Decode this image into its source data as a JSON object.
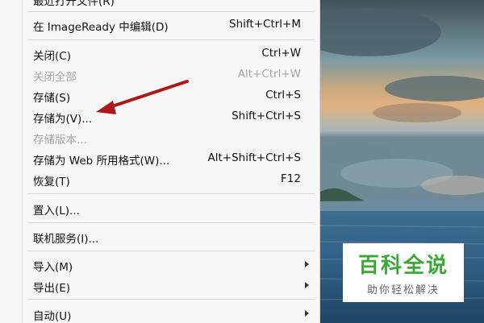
{
  "menu": {
    "top_partial": "最近打开文件(R)",
    "items": [
      {
        "label": "在 ImageReady 中编辑(D)",
        "shortcut": "Shift+Ctrl+M",
        "disabled": false
      },
      {
        "label": "关闭(C)",
        "shortcut": "Ctrl+W",
        "disabled": false
      },
      {
        "label": "关闭全部",
        "shortcut": "Alt+Ctrl+W",
        "disabled": true
      },
      {
        "label": "存储(S)",
        "shortcut": "Ctrl+S",
        "disabled": false
      },
      {
        "label": "存储为(V)...",
        "shortcut": "Shift+Ctrl+S",
        "disabled": false
      },
      {
        "label": "存储版本...",
        "shortcut": "",
        "disabled": true
      },
      {
        "label": "存储为 Web 所用格式(W)...",
        "shortcut": "Alt+Shift+Ctrl+S",
        "disabled": false
      },
      {
        "label": "恢复(T)",
        "shortcut": "F12",
        "disabled": false
      },
      {
        "label": "置入(L)...",
        "shortcut": "",
        "disabled": false
      },
      {
        "label": "联机服务(I)...",
        "shortcut": "",
        "disabled": false
      },
      {
        "label": "导入(M)",
        "shortcut": "",
        "disabled": false,
        "submenu": true
      },
      {
        "label": "导出(E)",
        "shortcut": "",
        "disabled": false,
        "submenu": true
      },
      {
        "label": "自动(U)",
        "shortcut": "",
        "disabled": false,
        "submenu": true
      }
    ]
  },
  "annotation": {
    "type": "red-arrow",
    "color": "#b01818",
    "points_to": "存储为(V)..."
  },
  "watermark": {
    "title": "百科全说",
    "subtitle": "助你轻松解决",
    "color": "#3aaa35"
  }
}
